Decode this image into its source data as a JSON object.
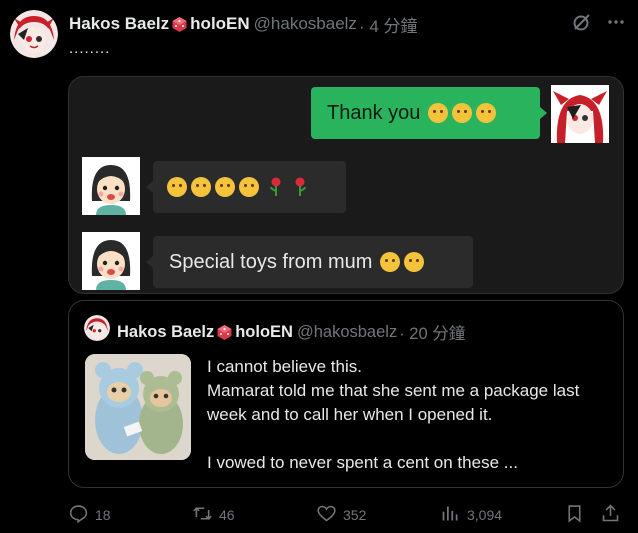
{
  "post": {
    "author_name": "Hakos Baelz",
    "author_suffix": "holoEN",
    "handle": "@hakosbaelz",
    "time": "· 4 分鐘",
    "text": "........",
    "more_icon": "ellipsis-icon",
    "grok_icon": "grok-icon"
  },
  "chat": {
    "msg1": "Thank you",
    "msg3": "Special toys from mum"
  },
  "quote": {
    "author_name": "Hakos Baelz",
    "author_suffix": "holoEN",
    "handle": "@hakosbaelz",
    "time": "· 20 分鐘",
    "text": "I cannot believe this.\nMamarat told me that she sent me a package last week and to call her when I opened it.\n\nI vowed to never spent a cent on these ..."
  },
  "actions": {
    "replies": "18",
    "reposts": "46",
    "likes": "352",
    "views": "3,094"
  },
  "colors": {
    "accent_green": "#29b35c",
    "muted": "#71767b"
  }
}
